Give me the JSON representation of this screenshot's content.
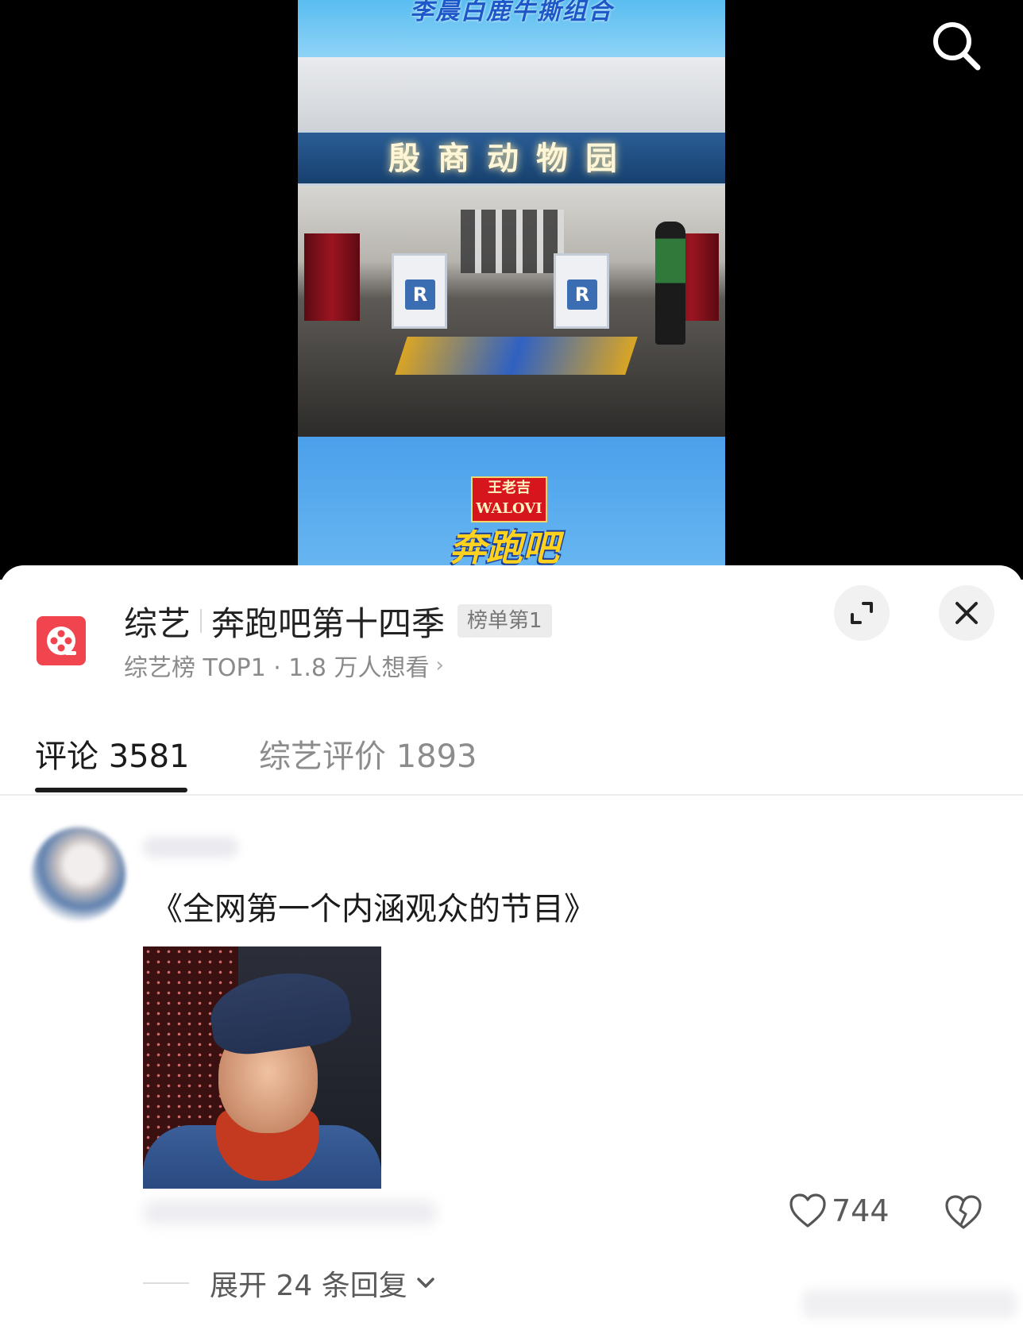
{
  "video": {
    "top_band_text": "李晨白鹿牛撕组合",
    "sign_text": "殷商动物园",
    "desk_letter": "R",
    "badge_text": "王老吉 WALOVI",
    "logo_text": "奔跑吧"
  },
  "header": {
    "category": "综艺",
    "show_name": "奔跑吧第十四季",
    "rank_badge": "榜单第1",
    "subtitle": "综艺榜 TOP1 · 1.8 万人想看",
    "subtitle_chevron": "›"
  },
  "tabs": [
    {
      "label": "评论 3581",
      "active": true
    },
    {
      "label": "综艺评价 1893",
      "active": false
    }
  ],
  "comment": {
    "text": "《全网第一个内涵观众的节目》",
    "likes": "744"
  },
  "replies": {
    "expand_label": "展开 24 条回复"
  },
  "icons": {
    "search": "search-icon",
    "show": "film-reel-icon",
    "expand": "expand-icon",
    "close": "close-icon",
    "like": "heart-icon",
    "dislike": "broken-heart-icon",
    "chevron": "chevron-down-icon"
  },
  "colors": {
    "accent_red": "#f0454e",
    "text_primary": "#1b1b1b",
    "text_secondary": "#8a8a8a"
  }
}
